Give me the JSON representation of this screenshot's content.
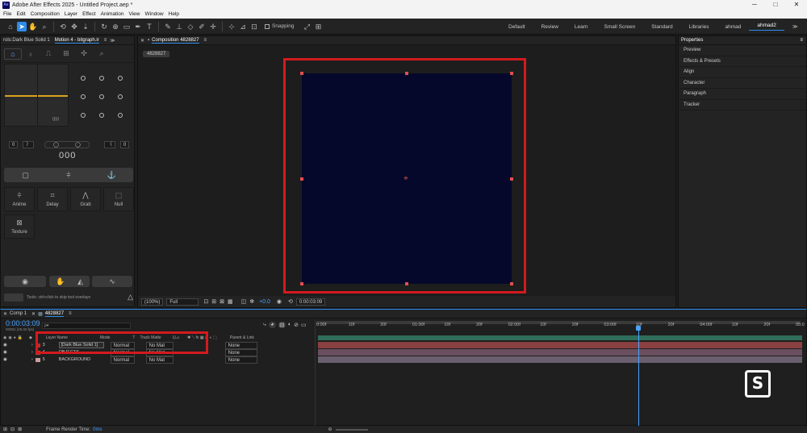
{
  "window": {
    "title": "Adobe After Effects 2025 - Untitled Project.aep *",
    "logo": "Ae"
  },
  "menu": [
    "File",
    "Edit",
    "Composition",
    "Layer",
    "Effect",
    "Animation",
    "View",
    "Window",
    "Help"
  ],
  "toolbar": {
    "snapping_label": "Snapping",
    "workspaces": [
      "Default",
      "Review",
      "Learn",
      "Small Screen",
      "Standard",
      "Libraries",
      "ahmad",
      "ahmad2"
    ],
    "active_workspace": "ahmad2"
  },
  "left_panel": {
    "tabs": [
      "rols:Dark Blue Solid 1",
      "Motion 4 - bitgraph.ir"
    ],
    "left_stepper": {
      "value": "0",
      "arrow": "〉"
    },
    "right_stepper": {
      "arrow": "〈",
      "value": "0"
    },
    "center_readout": "000",
    "tiles": [
      "Anime",
      "Delay",
      "Grab",
      "Null",
      "Texture"
    ],
    "hint": "Tools: ctrl+click to skip tool overlays",
    "jitter_label": "(((ı)"
  },
  "composition": {
    "panel_title": "Composition 4828827",
    "tab": "4828827",
    "zoom": "(100%)",
    "resolution": "Full",
    "exposure": "+0.0",
    "timecode": "0:00:03:09",
    "solid_color": "#05082a",
    "highlight_color": "#d31a1e"
  },
  "right_panel": {
    "title": "Properties",
    "items": [
      "Preview",
      "Effects & Presets",
      "Align",
      "Character",
      "Paragraph",
      "Tracker"
    ]
  },
  "timeline": {
    "tabs": [
      "Comp 1",
      "4828827"
    ],
    "current_time": "0:00:03:09",
    "time_sub": "00081 (25.00 fps)",
    "search_placeholder": "ρ▾",
    "columns": {
      "num": "#",
      "layer_name": "Layer Name",
      "mode": "Mode",
      "t": "T",
      "track_matte": "Track Matte",
      "parent": "Parent & Link"
    },
    "layers": [
      {
        "num": "3",
        "name": "[Dark Blue Solid 1]",
        "mode": "Normal",
        "matte": "No Mat",
        "parent": "None",
        "color": "#b03030"
      },
      {
        "num": "4",
        "name": "OBJECTS",
        "mode": "Normal",
        "matte": "No Mat",
        "parent": "None",
        "color": "#c04040"
      },
      {
        "num": "5",
        "name": "BACKGROUND",
        "mode": "Normal",
        "matte": "No Mat",
        "parent": "None",
        "color": "#c8a0a0"
      }
    ],
    "ruler": [
      "0:00f",
      "10f",
      "20f",
      "01:00f",
      "10f",
      "20f",
      "02:00f",
      "10f",
      "20f",
      "03:00f",
      "10f",
      "20f",
      "04:00f",
      "10f",
      "20f",
      "05:0"
    ],
    "playhead_seconds": 3.36
  },
  "status_bar": {
    "render_label": "Frame Render Time:",
    "render_value": "0ms"
  }
}
